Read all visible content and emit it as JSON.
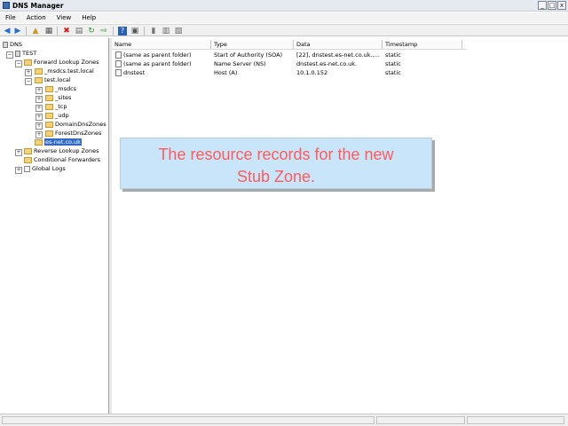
{
  "window": {
    "title": "DNS Manager",
    "minimize": "_",
    "maximize": "□",
    "close": "x"
  },
  "menu": [
    "File",
    "Action",
    "View",
    "Help"
  ],
  "toolbar": [
    "back-arrow",
    "forward-arrow",
    "up-folder",
    "show-hide-tree",
    "delete-x",
    "properties",
    "refresh",
    "export-list",
    "help",
    "view-toggle",
    "server-icon",
    "record-list",
    "record-detail"
  ],
  "tree": {
    "root": "DNS",
    "server": "TEST",
    "forward_zones": "Forward Lookup Zones",
    "msdcs_zone": "_msdcs.test.local",
    "test_local": "test.local",
    "children": [
      "_msdcs",
      "_sites",
      "_tcp",
      "_udp",
      "DomainDnsZones",
      "ForestDnsZones"
    ],
    "selected": "es-net.co.uk",
    "reverse_zones": "Reverse Lookup Zones",
    "conditional_forwarders": "Conditional Forwarders",
    "global_logs": "Global Logs"
  },
  "list": {
    "columns": [
      "Name",
      "Type",
      "Data",
      "Timestamp"
    ],
    "rows": [
      {
        "name": "(same as parent folder)",
        "type": "Start of Authority (SOA)",
        "data": "[22], dnstest.es-net.co.uk.,...",
        "timestamp": "static"
      },
      {
        "name": "(same as parent folder)",
        "type": "Name Server (NS)",
        "data": "dnstest.es-net.co.uk.",
        "timestamp": "static"
      },
      {
        "name": "dnstest",
        "type": "Host (A)",
        "data": "10.1.0.152",
        "timestamp": "static"
      }
    ]
  },
  "callout": {
    "line1": "The resource records for the new",
    "line2": "Stub Zone."
  },
  "colors": {
    "callout_bg": "#c9e5fa",
    "callout_text": "#ff5b5b",
    "selection": "#316ac5"
  }
}
